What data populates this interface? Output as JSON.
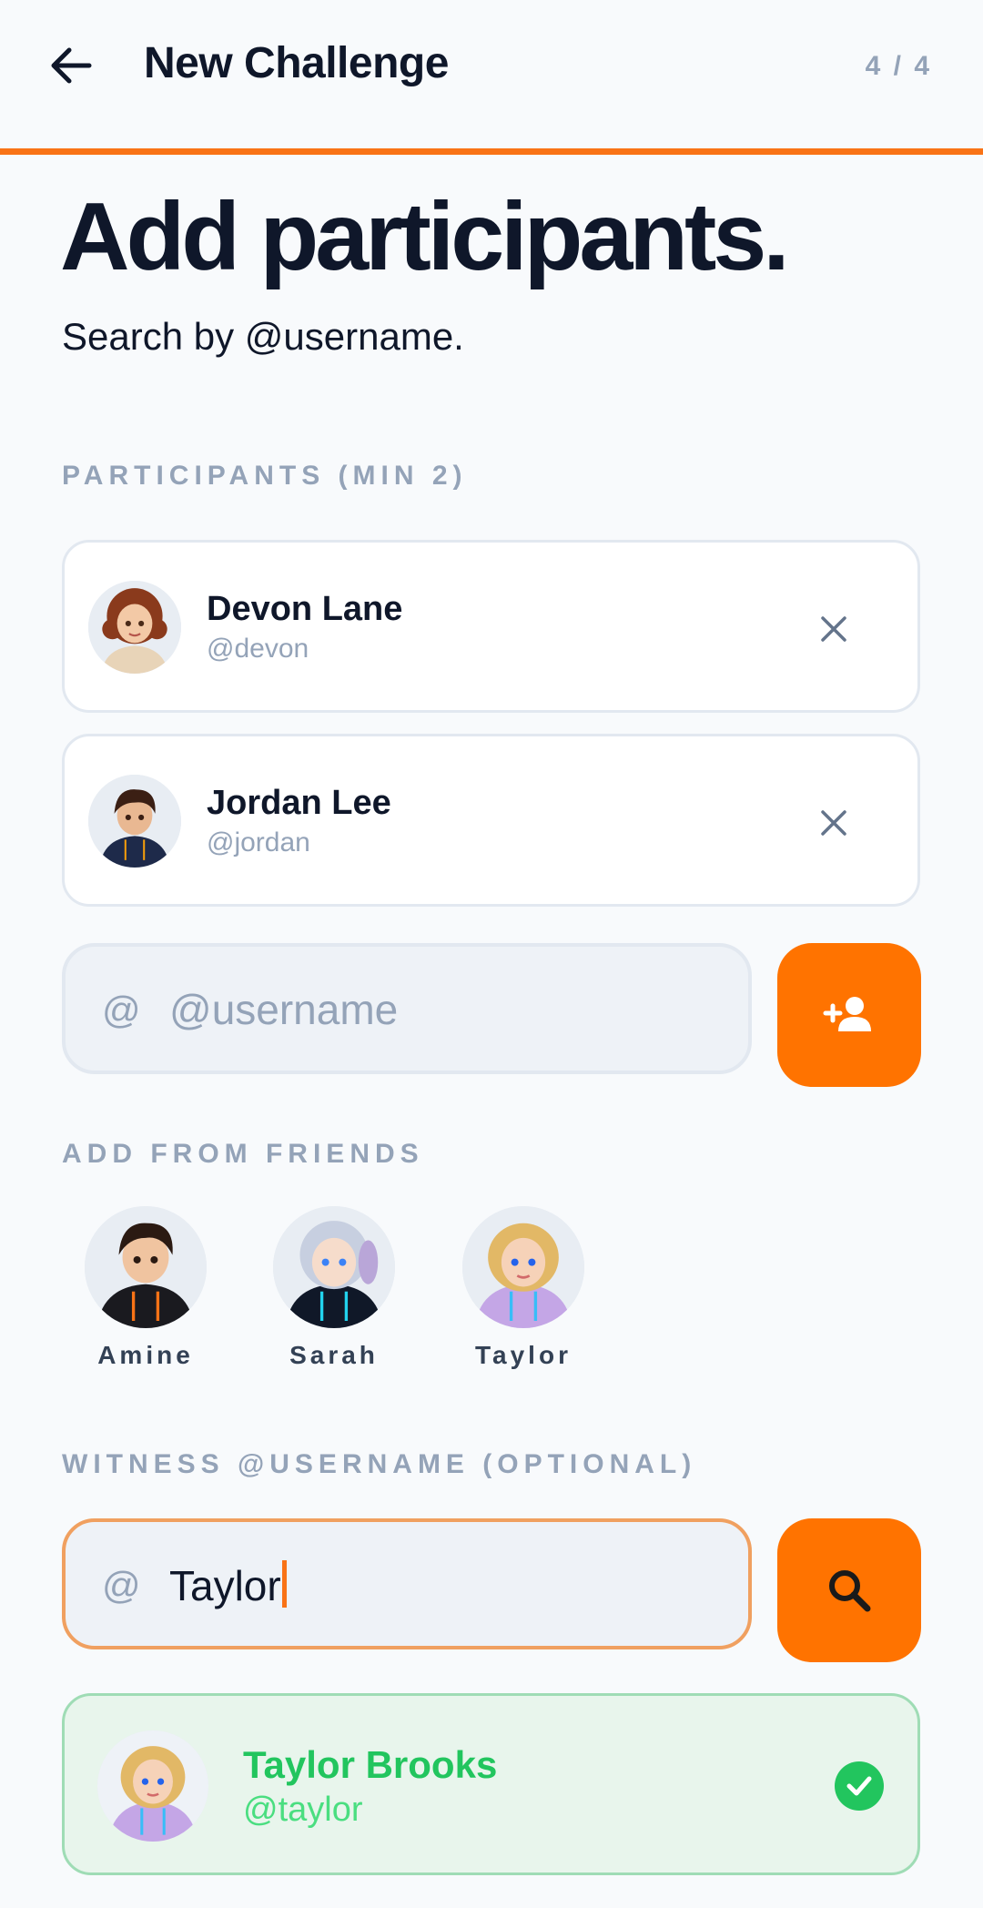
{
  "header": {
    "title": "New Challenge",
    "step": "4 / 4",
    "progress_fraction": 1.0
  },
  "page": {
    "title": "Add participants.",
    "subtitle": "Search by @username."
  },
  "participants": {
    "label": "PARTICIPANTS (MIN 2)",
    "items": [
      {
        "name": "Devon Lane",
        "handle": "@devon",
        "avatar": "girl-curly-hair-avatar"
      },
      {
        "name": "Jordan Lee",
        "handle": "@jordan",
        "avatar": "boy-navy-hoodie-avatar"
      }
    ]
  },
  "add_input": {
    "prefix": "@",
    "placeholder": "@username",
    "value": "",
    "button_icon": "add-person-icon"
  },
  "friends": {
    "label": "ADD FROM FRIENDS",
    "items": [
      {
        "name": "Amine",
        "avatar": "boy-black-hoodie-avatar"
      },
      {
        "name": "Sarah",
        "avatar": "girl-silver-hair-avatar"
      },
      {
        "name": "Taylor",
        "avatar": "girl-blonde-purple-hoodie-avatar"
      }
    ]
  },
  "witness": {
    "label": "WITNESS @USERNAME (OPTIONAL)",
    "prefix": "@",
    "value": "Taylor",
    "button_icon": "search-icon",
    "result": {
      "name": "Taylor Brooks",
      "handle": "@taylor",
      "selected": true
    }
  },
  "colors": {
    "accent": "#ff7300",
    "success": "#22c55e",
    "muted": "#94a3b8"
  }
}
